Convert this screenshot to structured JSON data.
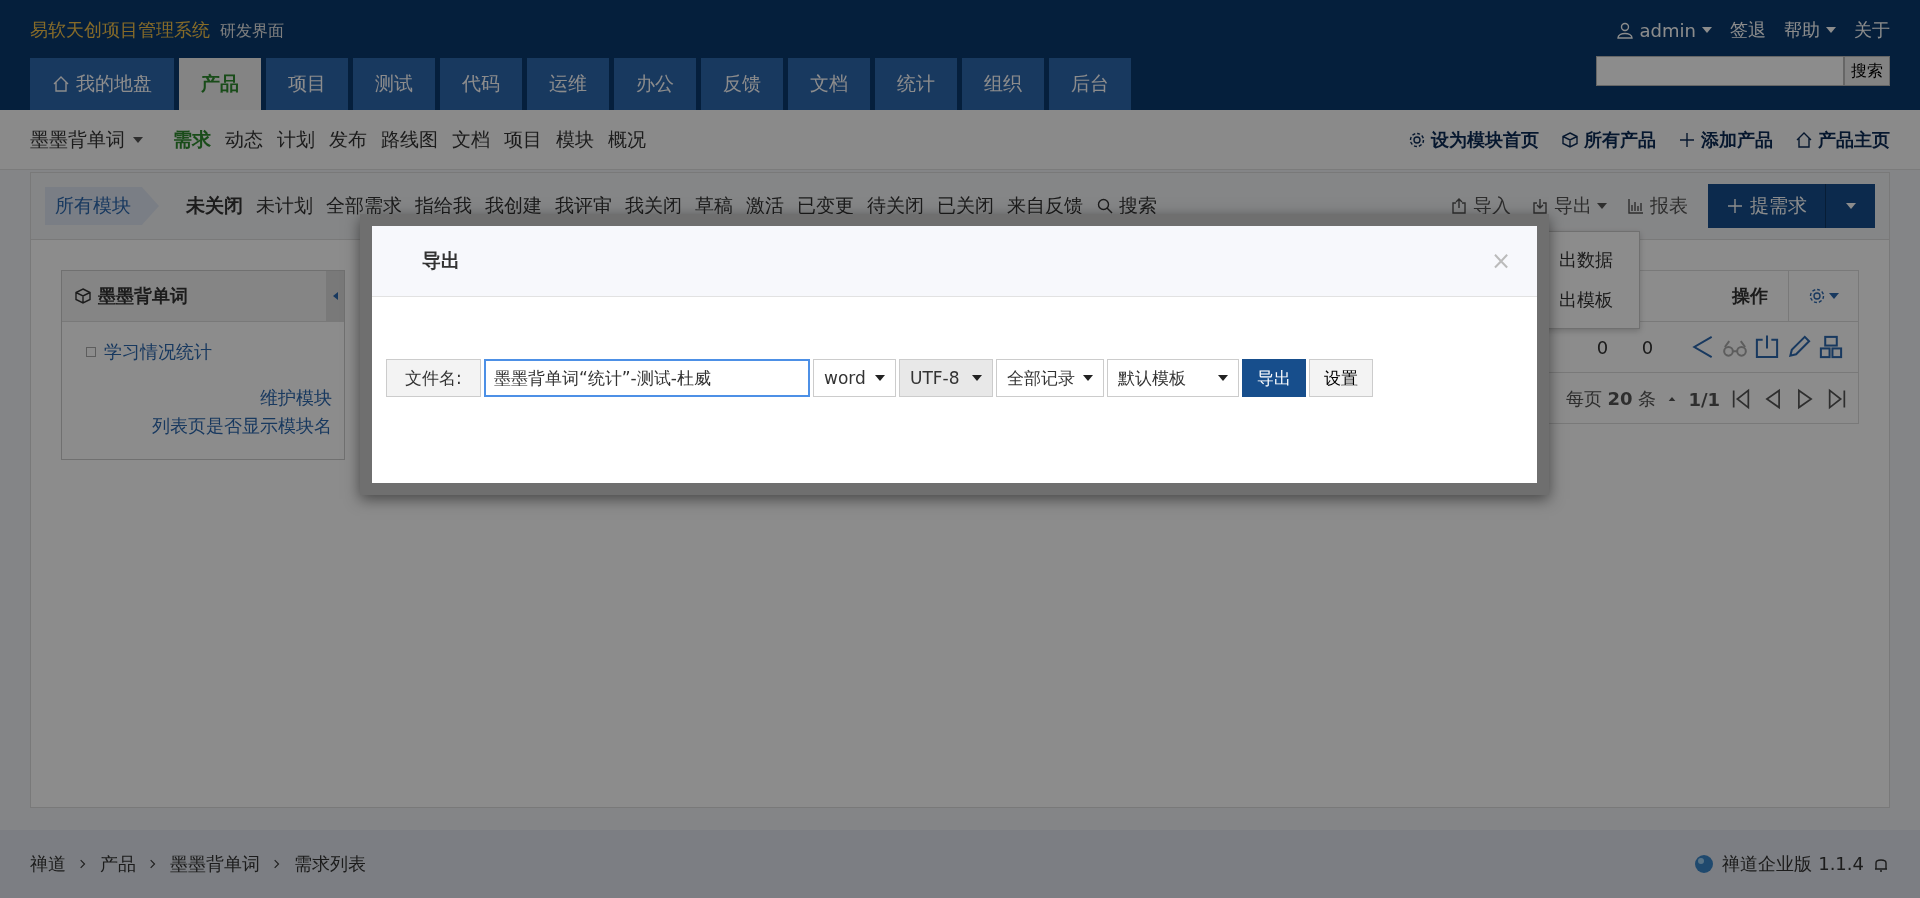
{
  "header": {
    "brand": "易软天创项目管理系统",
    "subtitle": "研发界面",
    "user": "admin",
    "logout": "签退",
    "help": "帮助",
    "about": "关于",
    "search_button": "搜索"
  },
  "nav_tabs": [
    {
      "label": "我的地盘",
      "kind": "home",
      "selected": false
    },
    {
      "label": "产品",
      "kind": "plain",
      "selected": true
    },
    {
      "label": "项目",
      "kind": "plain",
      "selected": false
    },
    {
      "label": "测试",
      "kind": "plain",
      "selected": false
    },
    {
      "label": "代码",
      "kind": "plain",
      "selected": false
    },
    {
      "label": "运维",
      "kind": "plain",
      "selected": false
    },
    {
      "label": "办公",
      "kind": "plain",
      "selected": false
    },
    {
      "label": "反馈",
      "kind": "plain",
      "selected": false
    },
    {
      "label": "文档",
      "kind": "plain",
      "selected": false
    },
    {
      "label": "统计",
      "kind": "plain",
      "selected": false
    },
    {
      "label": "组织",
      "kind": "plain",
      "selected": false
    },
    {
      "label": "后台",
      "kind": "plain",
      "selected": false
    }
  ],
  "subnav": {
    "product": "墨墨背单词",
    "items": [
      {
        "label": "需求",
        "selected": true
      },
      {
        "label": "动态",
        "selected": false
      },
      {
        "label": "计划",
        "selected": false
      },
      {
        "label": "发布",
        "selected": false
      },
      {
        "label": "路线图",
        "selected": false
      },
      {
        "label": "文档",
        "selected": false
      },
      {
        "label": "项目",
        "selected": false
      },
      {
        "label": "模块",
        "selected": false
      },
      {
        "label": "概况",
        "selected": false
      }
    ],
    "actions": [
      {
        "label": "设为模块首页",
        "kind": "gear"
      },
      {
        "label": "所有产品",
        "kind": "cube"
      },
      {
        "label": "添加产品",
        "kind": "plus"
      },
      {
        "label": "产品主页",
        "kind": "home"
      }
    ]
  },
  "filter": {
    "module": "所有模块",
    "items": [
      {
        "label": "未关闭",
        "selected": true
      },
      {
        "label": "未计划",
        "selected": false
      },
      {
        "label": "全部需求",
        "selected": false
      },
      {
        "label": "指给我",
        "selected": false
      },
      {
        "label": "我创建",
        "selected": false
      },
      {
        "label": "我评审",
        "selected": false
      },
      {
        "label": "我关闭",
        "selected": false
      },
      {
        "label": "草稿",
        "selected": false
      },
      {
        "label": "激活",
        "selected": false
      },
      {
        "label": "已变更",
        "selected": false
      },
      {
        "label": "待关闭",
        "selected": false
      },
      {
        "label": "已关闭",
        "selected": false
      },
      {
        "label": "来自反馈",
        "selected": false
      }
    ],
    "search": "搜索",
    "import": "导入",
    "export": "导出",
    "report": "报表",
    "create": "提需求"
  },
  "export_menu": [
    "出数据",
    "出模板"
  ],
  "sidebar": {
    "title": "墨墨背单词",
    "items": [
      "学习情况统计"
    ],
    "links": [
      "维护模块",
      "列表页是否显示模块名"
    ]
  },
  "table": {
    "header": "操作",
    "cells": [
      "0",
      "0"
    ],
    "per_page_prefix": "每页",
    "per_page": "20",
    "per_page_suffix": "条",
    "page": "1/1"
  },
  "dialog": {
    "title": "导出",
    "filename_label": "文件名:",
    "filename_value": "墨墨背单词“统计”-测试-杜威",
    "selects": [
      {
        "value": "word",
        "disabled": false
      },
      {
        "value": "UTF-8",
        "disabled": true
      },
      {
        "value": "全部记录",
        "disabled": false
      },
      {
        "value": "默认模板",
        "disabled": false
      }
    ],
    "submit": "导出",
    "settings": "设置",
    "close": "×"
  },
  "footer": {
    "breadcrumbs": [
      "禅道",
      "产品",
      "墨墨背单词",
      "需求列表"
    ],
    "version": "禅道企业版 1.1.4"
  }
}
